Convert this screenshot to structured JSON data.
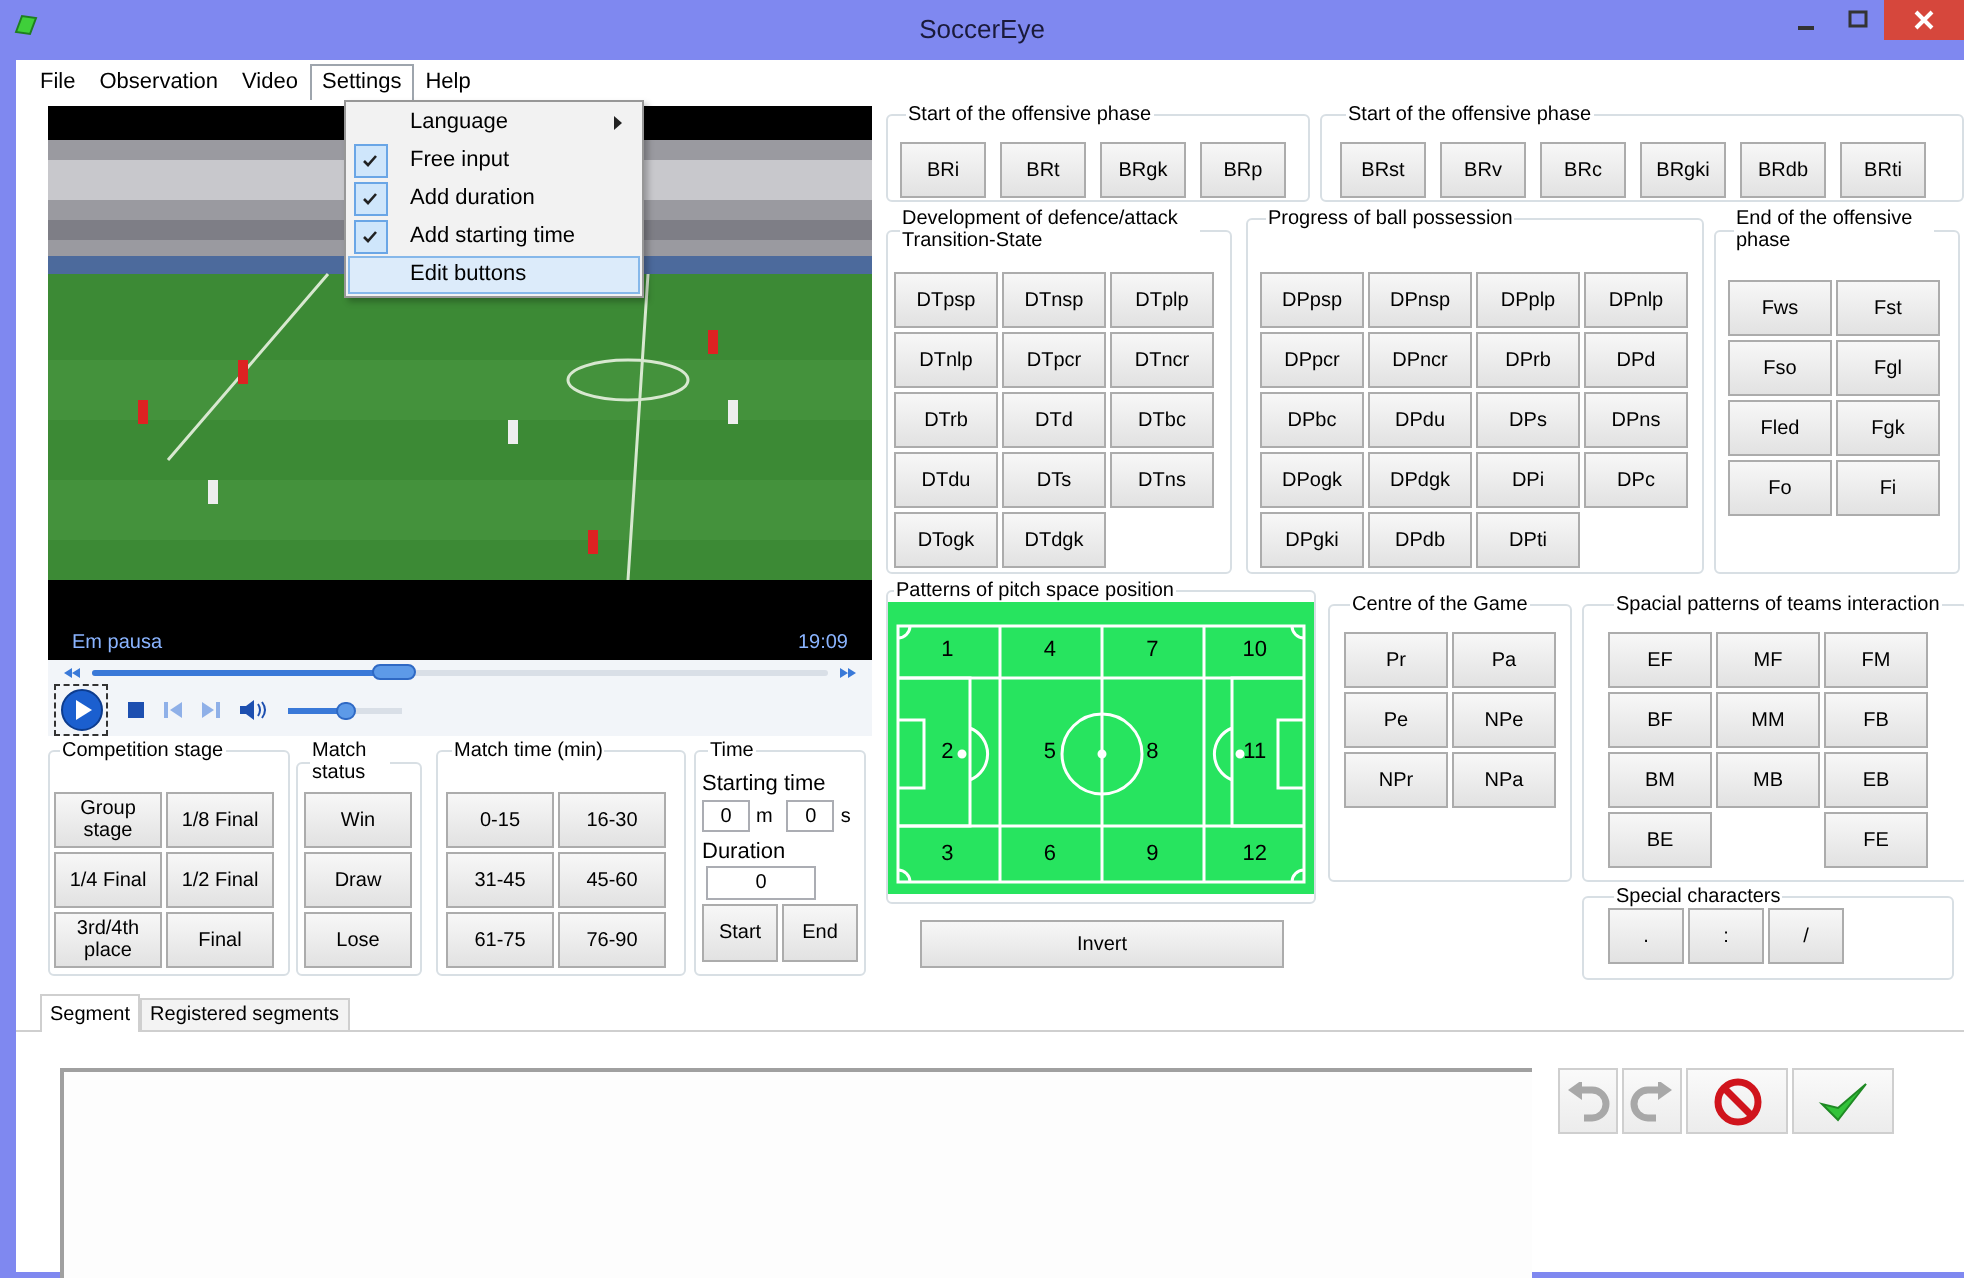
{
  "window": {
    "title": "SoccerEye"
  },
  "menu_bar": [
    {
      "label": "File",
      "selected": false
    },
    {
      "label": "Observation",
      "selected": false
    },
    {
      "label": "Video",
      "selected": false
    },
    {
      "label": "Settings",
      "selected": true
    },
    {
      "label": "Help",
      "selected": false
    }
  ],
  "settings_menu": [
    {
      "label": "Language",
      "kind": "submenu",
      "checked": false,
      "selected": false
    },
    {
      "label": "Free input",
      "kind": "toggle",
      "checked": true,
      "selected": false
    },
    {
      "label": "Add duration",
      "kind": "toggle",
      "checked": true,
      "selected": false
    },
    {
      "label": "Add starting time",
      "kind": "toggle",
      "checked": true,
      "selected": false
    },
    {
      "label": "Edit buttons",
      "kind": "command",
      "checked": false,
      "selected": true
    }
  ],
  "player": {
    "status": "Em pausa",
    "time": "19:09",
    "seek": {
      "level": 0.41
    },
    "volume": {
      "level": 0.5
    }
  },
  "competition_stage": {
    "title": "Competition stage",
    "buttons": [
      "Group stage",
      "1/8 Final",
      "1/4 Final",
      "1/2 Final",
      "3rd/4th place",
      "Final"
    ]
  },
  "match_status": {
    "title": "Match status",
    "buttons": [
      "Win",
      "Draw",
      "Lose"
    ]
  },
  "match_time": {
    "title": "Match time (min)",
    "buttons": [
      "0-15",
      "16-30",
      "31-45",
      "45-60",
      "61-75",
      "76-90"
    ]
  },
  "time": {
    "title": "Time",
    "starting_time_label": "Starting time",
    "minutes": "0",
    "minutes_unit": "m",
    "seconds": "0",
    "seconds_unit": "s",
    "duration_label": "Duration",
    "duration": "0",
    "buttons": [
      "Start",
      "End"
    ]
  },
  "start_offensive_a": {
    "title": "Start of the offensive phase",
    "buttons": [
      "BRi",
      "BRt",
      "BRgk",
      "BRp"
    ]
  },
  "start_offensive_b": {
    "title": "Start of the offensive phase",
    "buttons": [
      "BRst",
      "BRv",
      "BRc",
      "BRgki",
      "BRdb",
      "BRti"
    ]
  },
  "transition": {
    "title": "Development of defence/attack Transition-State",
    "buttons": [
      "DTpsp",
      "DTnsp",
      "DTplp",
      "DTnlp",
      "DTpcr",
      "DTncr",
      "DTrb",
      "DTd",
      "DTbc",
      "DTdu",
      "DTs",
      "DTns",
      "DTogk",
      "DTdgk"
    ]
  },
  "ball_possession": {
    "title": "Progress of ball possession",
    "buttons": [
      "DPpsp",
      "DPnsp",
      "DPplp",
      "DPnlp",
      "DPpcr",
      "DPncr",
      "DPrb",
      "DPd",
      "DPbc",
      "DPdu",
      "DPs",
      "DPns",
      "DPogk",
      "DPdgk",
      "DPi",
      "DPc",
      "DPgki",
      "DPdb",
      "DPti"
    ]
  },
  "end_offensive": {
    "title": "End of the offensive phase",
    "buttons": [
      "Fws",
      "Fst",
      "Fso",
      "Fgl",
      "Fled",
      "Fgk",
      "Fo",
      "Fi"
    ]
  },
  "pitch": {
    "title": "Patterns of pitch space position",
    "zones": [
      [
        "1",
        "4",
        "7",
        "10"
      ],
      [
        "2",
        "5",
        "8",
        "11"
      ],
      [
        "3",
        "6",
        "9",
        "12"
      ]
    ],
    "invert_button": "Invert"
  },
  "centre_of_game": {
    "title": "Centre of the Game",
    "buttons": [
      "Pr",
      "Pa",
      "Pe",
      "NPe",
      "NPr",
      "NPa"
    ]
  },
  "team_interaction": {
    "title": "Spacial patterns of teams interaction",
    "rows": [
      [
        "EF",
        "MF",
        "FM"
      ],
      [
        "BF",
        "MM",
        "FB"
      ],
      [
        "BM",
        "MB",
        "EB"
      ],
      [
        "BE",
        null,
        "FE"
      ]
    ]
  },
  "special_characters": {
    "title": "Special characters",
    "buttons": [
      ".",
      ":",
      "/"
    ]
  },
  "tabs": [
    {
      "label": "Segment",
      "selected": true
    },
    {
      "label": "Registered segments",
      "selected": false
    }
  ],
  "segment_actions": [
    {
      "kind": "undo",
      "disabled": true
    },
    {
      "kind": "redo",
      "disabled": true
    },
    {
      "kind": "cancel",
      "disabled": false
    },
    {
      "kind": "confirm",
      "disabled": false
    }
  ]
}
